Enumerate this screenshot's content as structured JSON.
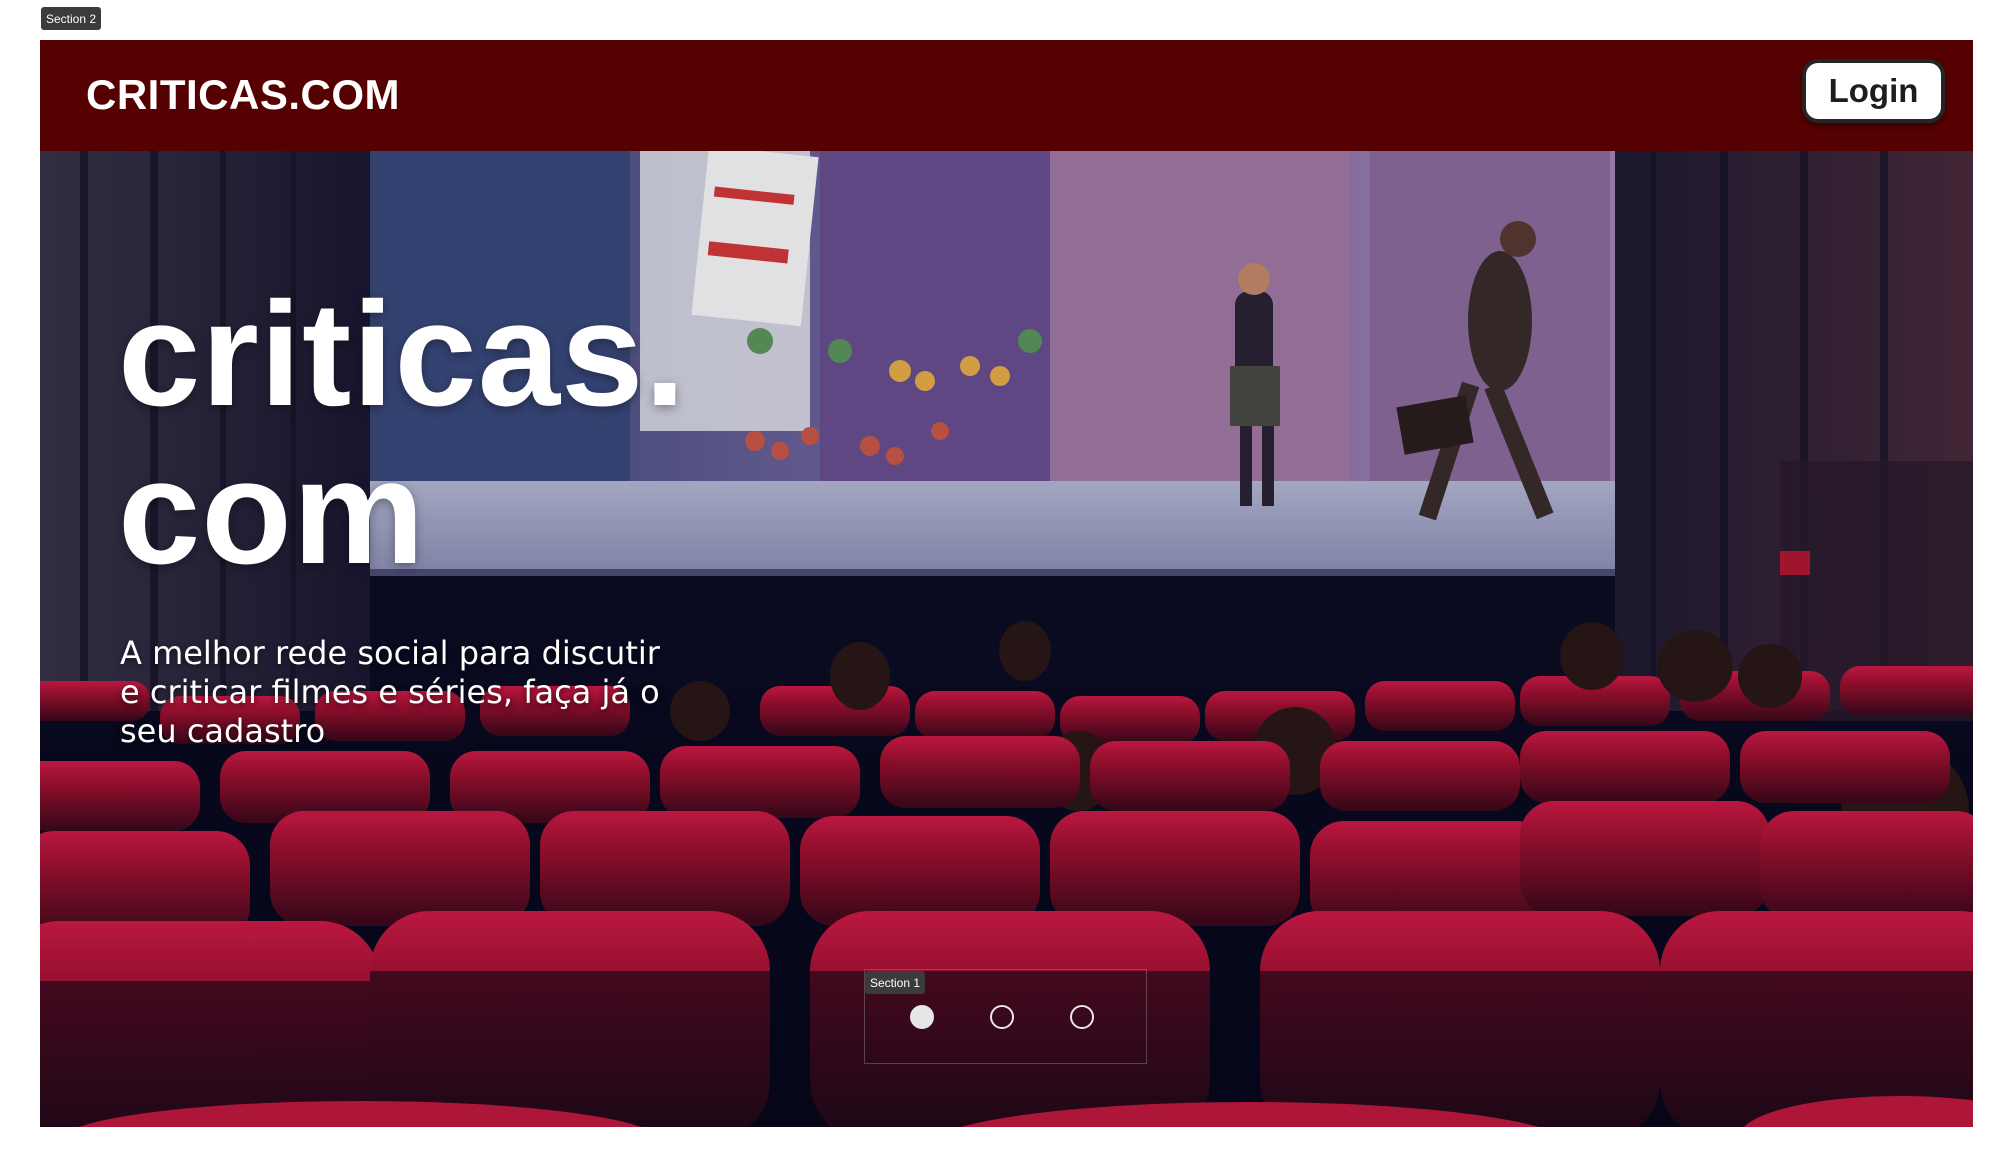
{
  "design_tags": {
    "outer": "Section 2",
    "inner": "Section 1"
  },
  "header": {
    "brand": "CRITICAS.COM",
    "login_label": "Login"
  },
  "hero": {
    "title_line1": "criticas.",
    "title_line2": "com",
    "subtitle": "A melhor rede social para discutir e criticar filmes e séries, faça já o seu cadastro",
    "background_image": "cinema auditorium with red seats and audience watching an animated film on a large screen"
  },
  "carousel": {
    "slide_count": 3,
    "active_slide": 1
  },
  "colors": {
    "header_bg": "#560101",
    "seat_red": "#b81236",
    "theater_dark": "#0a0a22",
    "text_white": "#ffffff"
  }
}
